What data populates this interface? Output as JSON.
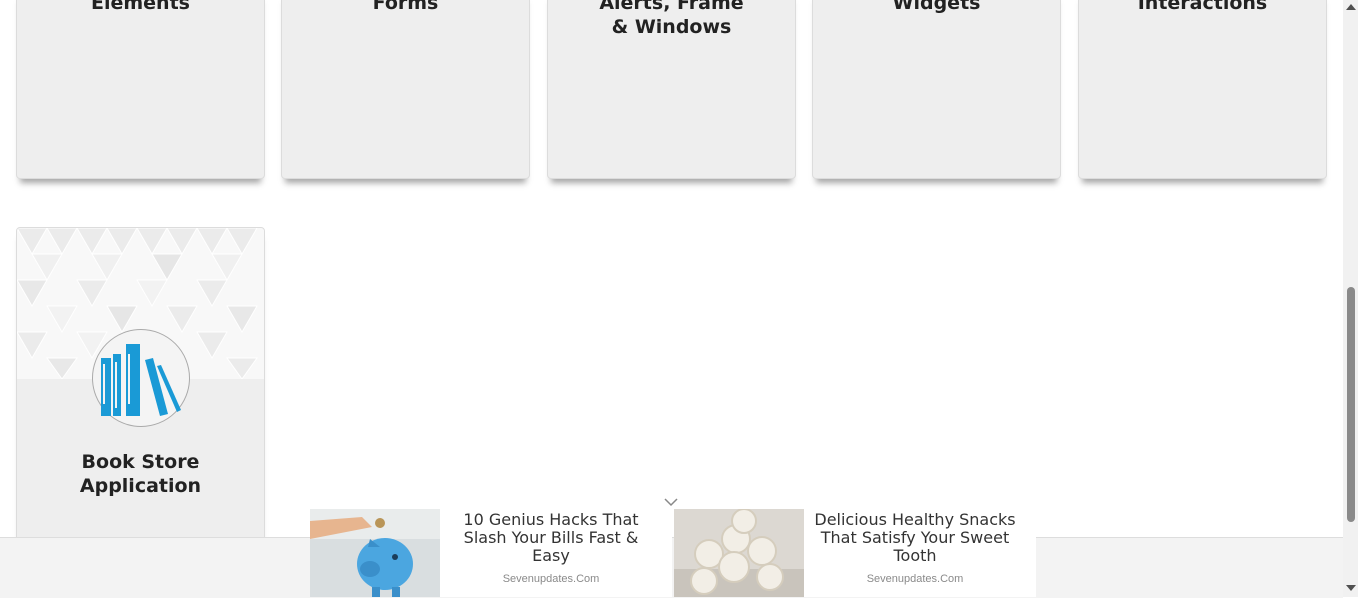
{
  "categories": {
    "elements": "Elements",
    "forms": "Forms",
    "alerts": "Alerts, Frame & Windows",
    "widgets": "Widgets",
    "interactions": "Interactions",
    "book_store": "Book Store Application"
  },
  "icons": {
    "book_store": "books-icon",
    "ad_collapse": "chevron-down-icon"
  },
  "ads": [
    {
      "title": "10 Genius Hacks That Slash Your Bills Fast & Easy",
      "source": "Sevenupdates.Com",
      "image": "piggy-bank-image"
    },
    {
      "title": "Delicious Healthy Snacks That Satisfy Your Sweet Tooth",
      "source": "Sevenupdates.Com",
      "image": "coconut-balls-image"
    }
  ],
  "colors": {
    "card_bg": "#eeeeee",
    "icon_blue": "#1a9ad6",
    "ad_bar_bg": "#f3f3f3"
  }
}
